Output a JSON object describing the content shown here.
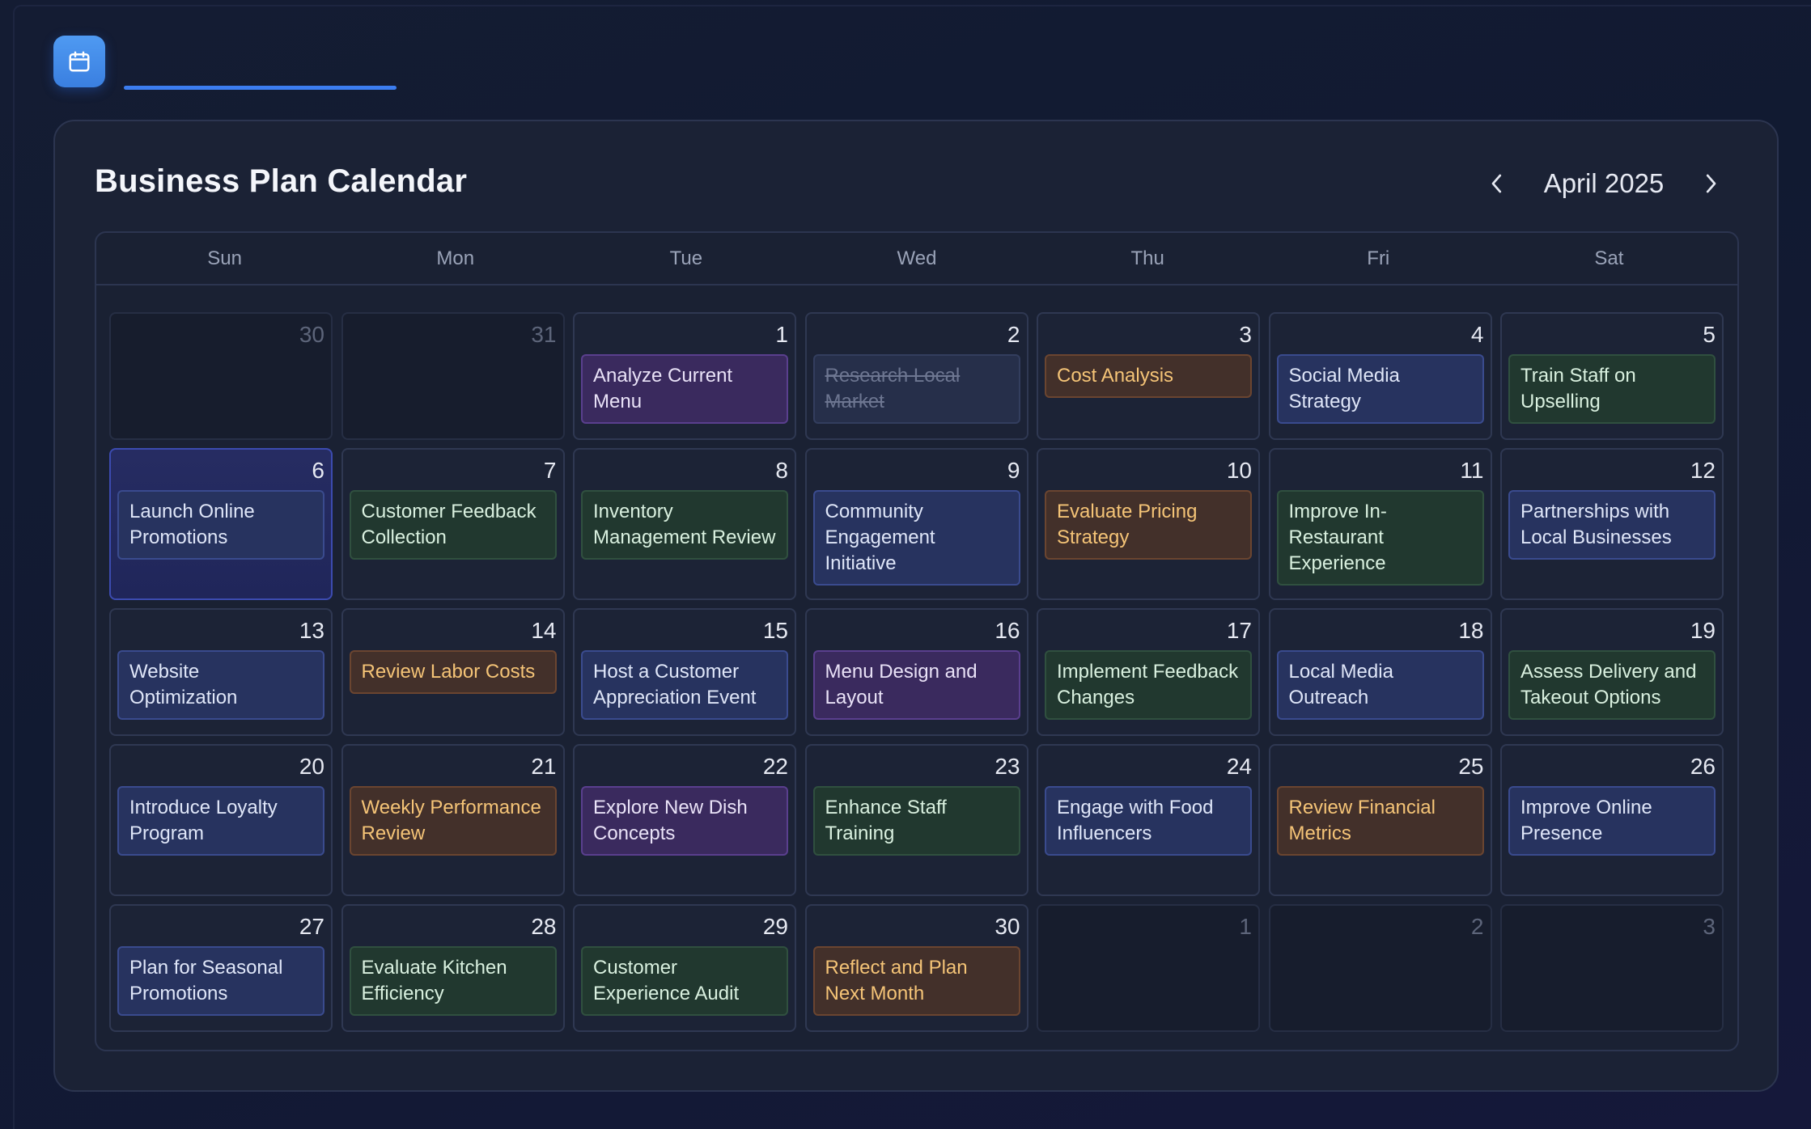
{
  "header": {
    "app_icon": "calendar-icon"
  },
  "panel": {
    "title": "Business Plan Calendar",
    "month_label": "April 2025",
    "prev_icon": "chevron-left-icon",
    "next_icon": "chevron-right-icon"
  },
  "weekdays": [
    "Sun",
    "Mon",
    "Tue",
    "Wed",
    "Thu",
    "Fri",
    "Sat"
  ],
  "colors": {
    "purple": "#3a2a5e",
    "blue": "#27335f",
    "green": "#21382f",
    "orange": "#43302a",
    "accent": "#3c7df0"
  },
  "weeks": [
    [
      {
        "day": "30",
        "other": true
      },
      {
        "day": "31",
        "other": true
      },
      {
        "day": "1",
        "event": "Analyze Current Menu",
        "color": "purple"
      },
      {
        "day": "2",
        "event": "Research Local Market",
        "color": "done"
      },
      {
        "day": "3",
        "event": "Cost Analysis",
        "color": "orange"
      },
      {
        "day": "4",
        "event": "Social Media Strategy",
        "color": "blue"
      },
      {
        "day": "5",
        "event": "Train Staff on Upselling",
        "color": "green"
      }
    ],
    [
      {
        "day": "6",
        "event": "Launch Online Promotions",
        "color": "blue",
        "today": true
      },
      {
        "day": "7",
        "event": "Customer Feedback Collection",
        "color": "green"
      },
      {
        "day": "8",
        "event": "Inventory Management Review",
        "color": "green"
      },
      {
        "day": "9",
        "event": "Community Engagement Initiative",
        "color": "blue"
      },
      {
        "day": "10",
        "event": "Evaluate Pricing Strategy",
        "color": "orange"
      },
      {
        "day": "11",
        "event": "Improve In-Restaurant Experience",
        "color": "green"
      },
      {
        "day": "12",
        "event": "Partnerships with Local Businesses",
        "color": "blue"
      }
    ],
    [
      {
        "day": "13",
        "event": "Website Optimization",
        "color": "blue"
      },
      {
        "day": "14",
        "event": "Review Labor Costs",
        "color": "orange"
      },
      {
        "day": "15",
        "event": "Host a Customer Appreciation Event",
        "color": "blue"
      },
      {
        "day": "16",
        "event": "Menu Design and Layout",
        "color": "purple"
      },
      {
        "day": "17",
        "event": "Implement Feedback Changes",
        "color": "green"
      },
      {
        "day": "18",
        "event": "Local Media Outreach",
        "color": "blue"
      },
      {
        "day": "19",
        "event": "Assess Delivery and Takeout Options",
        "color": "green"
      }
    ],
    [
      {
        "day": "20",
        "event": "Introduce Loyalty Program",
        "color": "blue"
      },
      {
        "day": "21",
        "event": "Weekly Performance Review",
        "color": "orange"
      },
      {
        "day": "22",
        "event": "Explore New Dish Concepts",
        "color": "purple"
      },
      {
        "day": "23",
        "event": "Enhance Staff Training",
        "color": "green"
      },
      {
        "day": "24",
        "event": "Engage with Food Influencers",
        "color": "blue"
      },
      {
        "day": "25",
        "event": "Review Financial Metrics",
        "color": "orange"
      },
      {
        "day": "26",
        "event": "Improve Online Presence",
        "color": "blue"
      }
    ],
    [
      {
        "day": "27",
        "event": "Plan for Seasonal Promotions",
        "color": "blue"
      },
      {
        "day": "28",
        "event": "Evaluate Kitchen Efficiency",
        "color": "green"
      },
      {
        "day": "29",
        "event": "Customer Experience Audit",
        "color": "green"
      },
      {
        "day": "30",
        "event": "Reflect and Plan Next Month",
        "color": "orange"
      },
      {
        "day": "1",
        "other": true
      },
      {
        "day": "2",
        "other": true
      },
      {
        "day": "3",
        "other": true
      }
    ]
  ]
}
